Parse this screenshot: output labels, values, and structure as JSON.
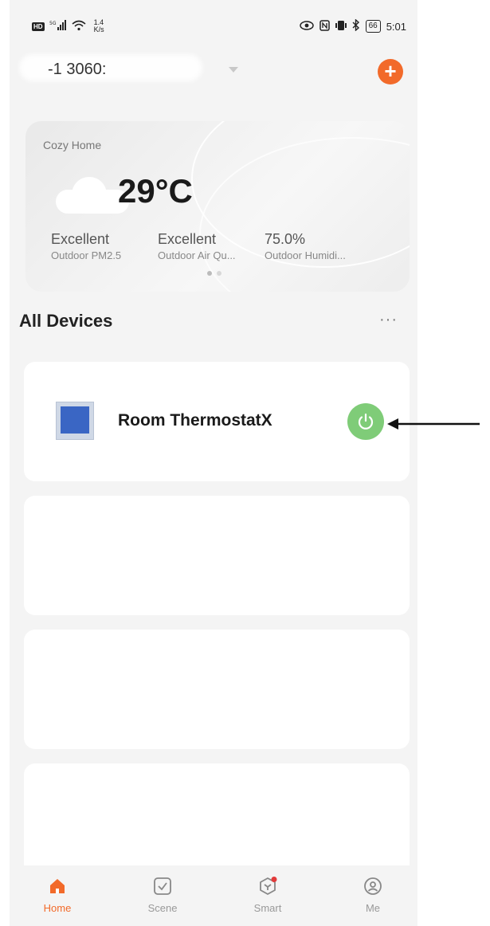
{
  "status_bar": {
    "hd": "HD",
    "network": "5G",
    "speed_value": "1.4",
    "speed_unit": "K/s",
    "battery": "66",
    "time": "5:01"
  },
  "home": {
    "name": "-1 3060:"
  },
  "weather": {
    "home_label": "Cozy Home",
    "temperature": "29°C",
    "stats": [
      {
        "value": "Excellent",
        "label": "Outdoor PM2.5"
      },
      {
        "value": "Excellent",
        "label": "Outdoor Air Qu..."
      },
      {
        "value": "75.0%",
        "label": "Outdoor Humidi..."
      }
    ]
  },
  "devices_section": {
    "title": "All Devices",
    "more": "···"
  },
  "devices": [
    {
      "name": "Room ThermostatX",
      "power_color": "#7fcc78"
    }
  ],
  "tabbar": {
    "tabs": [
      {
        "label": "Home",
        "icon": "home-icon"
      },
      {
        "label": "Scene",
        "icon": "scene-icon"
      },
      {
        "label": "Smart",
        "icon": "smart-icon"
      },
      {
        "label": "Me",
        "icon": "me-icon"
      }
    ]
  },
  "colors": {
    "accent": "#f26a2a",
    "power_on": "#7fcc78"
  }
}
